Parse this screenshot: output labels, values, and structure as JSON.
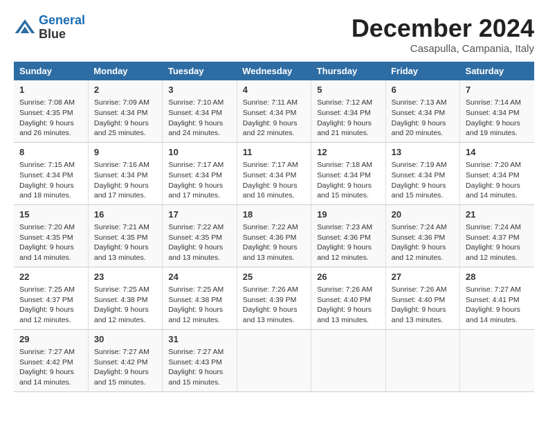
{
  "header": {
    "logo_line1": "General",
    "logo_line2": "Blue",
    "month": "December 2024",
    "location": "Casapulla, Campania, Italy"
  },
  "weekdays": [
    "Sunday",
    "Monday",
    "Tuesday",
    "Wednesday",
    "Thursday",
    "Friday",
    "Saturday"
  ],
  "weeks": [
    [
      {
        "day": "1",
        "sunrise": "7:08 AM",
        "sunset": "4:35 PM",
        "daylight": "9 hours and 26 minutes."
      },
      {
        "day": "2",
        "sunrise": "7:09 AM",
        "sunset": "4:34 PM",
        "daylight": "9 hours and 25 minutes."
      },
      {
        "day": "3",
        "sunrise": "7:10 AM",
        "sunset": "4:34 PM",
        "daylight": "9 hours and 24 minutes."
      },
      {
        "day": "4",
        "sunrise": "7:11 AM",
        "sunset": "4:34 PM",
        "daylight": "9 hours and 22 minutes."
      },
      {
        "day": "5",
        "sunrise": "7:12 AM",
        "sunset": "4:34 PM",
        "daylight": "9 hours and 21 minutes."
      },
      {
        "day": "6",
        "sunrise": "7:13 AM",
        "sunset": "4:34 PM",
        "daylight": "9 hours and 20 minutes."
      },
      {
        "day": "7",
        "sunrise": "7:14 AM",
        "sunset": "4:34 PM",
        "daylight": "9 hours and 19 minutes."
      }
    ],
    [
      {
        "day": "8",
        "sunrise": "7:15 AM",
        "sunset": "4:34 PM",
        "daylight": "9 hours and 18 minutes."
      },
      {
        "day": "9",
        "sunrise": "7:16 AM",
        "sunset": "4:34 PM",
        "daylight": "9 hours and 17 minutes."
      },
      {
        "day": "10",
        "sunrise": "7:17 AM",
        "sunset": "4:34 PM",
        "daylight": "9 hours and 17 minutes."
      },
      {
        "day": "11",
        "sunrise": "7:17 AM",
        "sunset": "4:34 PM",
        "daylight": "9 hours and 16 minutes."
      },
      {
        "day": "12",
        "sunrise": "7:18 AM",
        "sunset": "4:34 PM",
        "daylight": "9 hours and 15 minutes."
      },
      {
        "day": "13",
        "sunrise": "7:19 AM",
        "sunset": "4:34 PM",
        "daylight": "9 hours and 15 minutes."
      },
      {
        "day": "14",
        "sunrise": "7:20 AM",
        "sunset": "4:34 PM",
        "daylight": "9 hours and 14 minutes."
      }
    ],
    [
      {
        "day": "15",
        "sunrise": "7:20 AM",
        "sunset": "4:35 PM",
        "daylight": "9 hours and 14 minutes."
      },
      {
        "day": "16",
        "sunrise": "7:21 AM",
        "sunset": "4:35 PM",
        "daylight": "9 hours and 13 minutes."
      },
      {
        "day": "17",
        "sunrise": "7:22 AM",
        "sunset": "4:35 PM",
        "daylight": "9 hours and 13 minutes."
      },
      {
        "day": "18",
        "sunrise": "7:22 AM",
        "sunset": "4:36 PM",
        "daylight": "9 hours and 13 minutes."
      },
      {
        "day": "19",
        "sunrise": "7:23 AM",
        "sunset": "4:36 PM",
        "daylight": "9 hours and 12 minutes."
      },
      {
        "day": "20",
        "sunrise": "7:24 AM",
        "sunset": "4:36 PM",
        "daylight": "9 hours and 12 minutes."
      },
      {
        "day": "21",
        "sunrise": "7:24 AM",
        "sunset": "4:37 PM",
        "daylight": "9 hours and 12 minutes."
      }
    ],
    [
      {
        "day": "22",
        "sunrise": "7:25 AM",
        "sunset": "4:37 PM",
        "daylight": "9 hours and 12 minutes."
      },
      {
        "day": "23",
        "sunrise": "7:25 AM",
        "sunset": "4:38 PM",
        "daylight": "9 hours and 12 minutes."
      },
      {
        "day": "24",
        "sunrise": "7:25 AM",
        "sunset": "4:38 PM",
        "daylight": "9 hours and 12 minutes."
      },
      {
        "day": "25",
        "sunrise": "7:26 AM",
        "sunset": "4:39 PM",
        "daylight": "9 hours and 13 minutes."
      },
      {
        "day": "26",
        "sunrise": "7:26 AM",
        "sunset": "4:40 PM",
        "daylight": "9 hours and 13 minutes."
      },
      {
        "day": "27",
        "sunrise": "7:26 AM",
        "sunset": "4:40 PM",
        "daylight": "9 hours and 13 minutes."
      },
      {
        "day": "28",
        "sunrise": "7:27 AM",
        "sunset": "4:41 PM",
        "daylight": "9 hours and 14 minutes."
      }
    ],
    [
      {
        "day": "29",
        "sunrise": "7:27 AM",
        "sunset": "4:42 PM",
        "daylight": "9 hours and 14 minutes."
      },
      {
        "day": "30",
        "sunrise": "7:27 AM",
        "sunset": "4:42 PM",
        "daylight": "9 hours and 15 minutes."
      },
      {
        "day": "31",
        "sunrise": "7:27 AM",
        "sunset": "4:43 PM",
        "daylight": "9 hours and 15 minutes."
      },
      null,
      null,
      null,
      null
    ]
  ]
}
